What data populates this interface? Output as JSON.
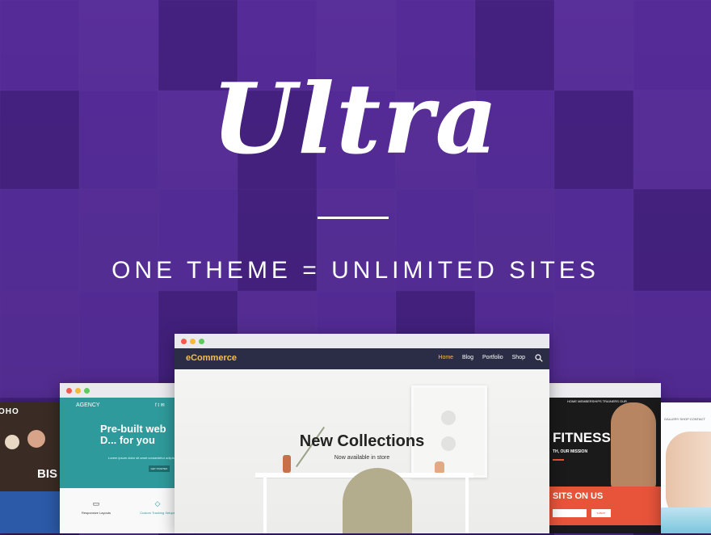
{
  "hero": {
    "title": "Ultra",
    "tagline": "ONE THEME = UNLIMITED SITES"
  },
  "main_window": {
    "brand": "eCommerce",
    "menu": [
      "Home",
      "Blog",
      "Portfolio",
      "Shop"
    ],
    "heading": "New Collections",
    "subheading": "Now available in store"
  },
  "agency_window": {
    "logo": "AGENCY",
    "social": "f  t  ✉",
    "heading": "Pre-built web D... for you",
    "tagline_small": "Lorem ipsum dolor sit amet consectetur adipiscing",
    "button": "GET STARTED",
    "features": [
      "Responsive Layouts",
      "Custom Tracking Setups"
    ]
  },
  "left_window": {
    "text_top": "OHO",
    "text_bottom": "BIS"
  },
  "fitness_window": {
    "nav": "HOME   MEMBERSHIPS   TRAINERS   OUR",
    "heading": "FITNESS",
    "subheading": "TH, OUR MISSION",
    "visit": "SITS ON US",
    "submit": "SUBMIT"
  },
  "beauty_window": {
    "nav": "GALLERY   SHOP   CONTACT"
  },
  "colors": {
    "accent_purple": "#4b2a86",
    "ecommerce_nav": "#2b2c45",
    "brand_gold": "#f1c24b",
    "agency_teal": "#2f9a9b",
    "fitness_orange": "#e8543a"
  }
}
